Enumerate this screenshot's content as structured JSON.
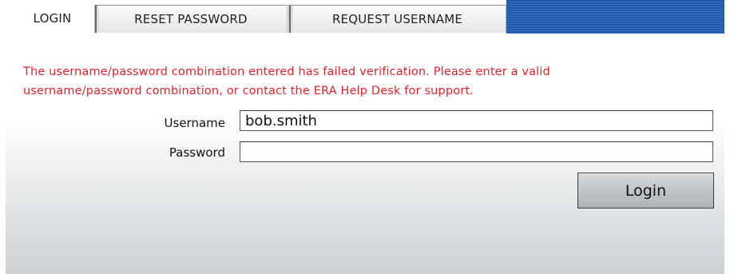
{
  "tabs": [
    {
      "label": "LOGIN",
      "active": true
    },
    {
      "label": "RESET PASSWORD",
      "active": false
    },
    {
      "label": "REQUEST USERNAME",
      "active": false
    }
  ],
  "error": {
    "line1": "The username/password combination entered has failed verification. Please enter a valid",
    "line2": "username/password combination, or contact the ERA Help Desk for support.",
    "color": "#e8202a"
  },
  "form": {
    "username_label": "Username",
    "username_value": "bob.smith",
    "password_label": "Password",
    "password_value": "",
    "login_label": "Login"
  },
  "colors": {
    "tabbar_blue": "#1f56a8",
    "button_gray": "#aeb2b6"
  }
}
